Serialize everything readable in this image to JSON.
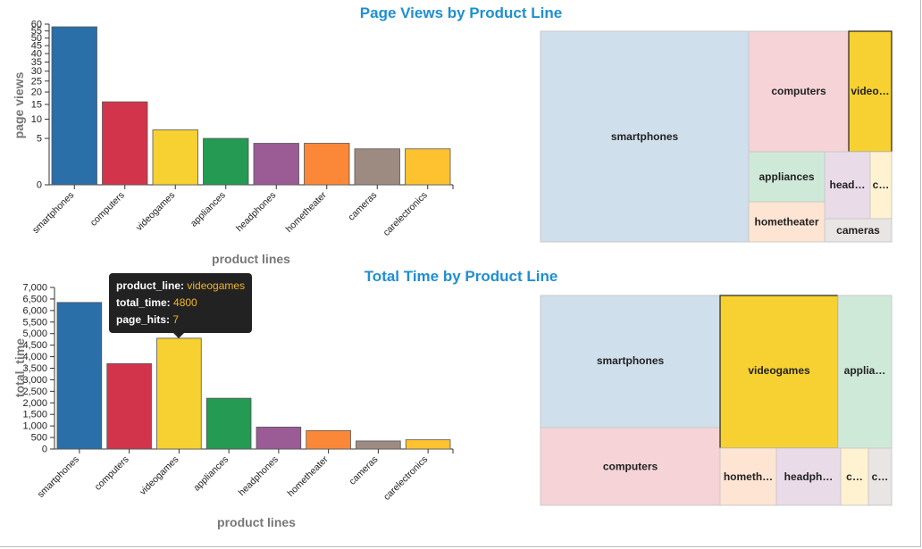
{
  "colors": {
    "smartphones": "#2a6fa8",
    "computers": "#d2354b",
    "videogames": "#f7d131",
    "appliances": "#249a53",
    "headphones": "#9b5b95",
    "hometheater": "#fb8838",
    "cameras": "#9d8b82",
    "carelectronics": "#fec230",
    "title": "#1f8fd0"
  },
  "chart_data": [
    {
      "type": "bar",
      "title": "Page Views by Product Line",
      "xlabel": "product lines",
      "ylabel": "page views",
      "scale": "sqrt",
      "ylim": [
        0,
        60
      ],
      "yticks": [
        "0",
        "5",
        "10",
        "15",
        "20",
        "25",
        "30",
        "35",
        "40",
        "45",
        "50",
        "55",
        "60"
      ],
      "categories": [
        "smartphones",
        "computers",
        "videogames",
        "appliances",
        "headphones",
        "hometheater",
        "cameras",
        "carelectronics"
      ],
      "values": [
        58,
        16,
        7,
        5,
        4,
        4,
        3,
        3
      ],
      "grid": false
    },
    {
      "type": "treemap",
      "items": [
        {
          "label": "smartphones",
          "value": 58
        },
        {
          "label": "computers",
          "value": 16
        },
        {
          "label": "video…",
          "value": 7
        },
        {
          "label": "appliances",
          "value": 5
        },
        {
          "label": "head…",
          "value": 4
        },
        {
          "label": "c…",
          "value": 3
        },
        {
          "label": "hometheater",
          "value": 4
        },
        {
          "label": "cameras",
          "value": 3
        }
      ]
    },
    {
      "type": "bar",
      "title": "Total Time by Product Line",
      "xlabel": "product lines",
      "ylabel": "total_time",
      "ylim": [
        0,
        7000
      ],
      "yticks": [
        "0",
        "500",
        "1,000",
        "1,500",
        "2,000",
        "2,500",
        "3,000",
        "3,500",
        "4,000",
        "4,500",
        "5,000",
        "5,500",
        "6,000",
        "6,500",
        "7,000"
      ],
      "categories": [
        "smartphones",
        "computers",
        "videogames",
        "appliances",
        "headphones",
        "hometheater",
        "cameras",
        "carelectronics"
      ],
      "values": [
        6350,
        3700,
        4800,
        2200,
        950,
        800,
        350,
        400
      ],
      "grid": false
    },
    {
      "type": "treemap",
      "items": [
        {
          "label": "smartphones",
          "value": 6350
        },
        {
          "label": "computers",
          "value": 3700
        },
        {
          "label": "videogames",
          "value": 4800
        },
        {
          "label": "applia…",
          "value": 2200
        },
        {
          "label": "hometh…",
          "value": 800
        },
        {
          "label": "headph…",
          "value": 950
        },
        {
          "label": "c…",
          "value": 400
        },
        {
          "label": "c…",
          "value": 350
        }
      ]
    }
  ],
  "tooltip": {
    "k1": "product_line:",
    "v1": "videogames",
    "k2": "total_time:",
    "v2": "4800",
    "k3": "page_hits:",
    "v3": "7"
  }
}
